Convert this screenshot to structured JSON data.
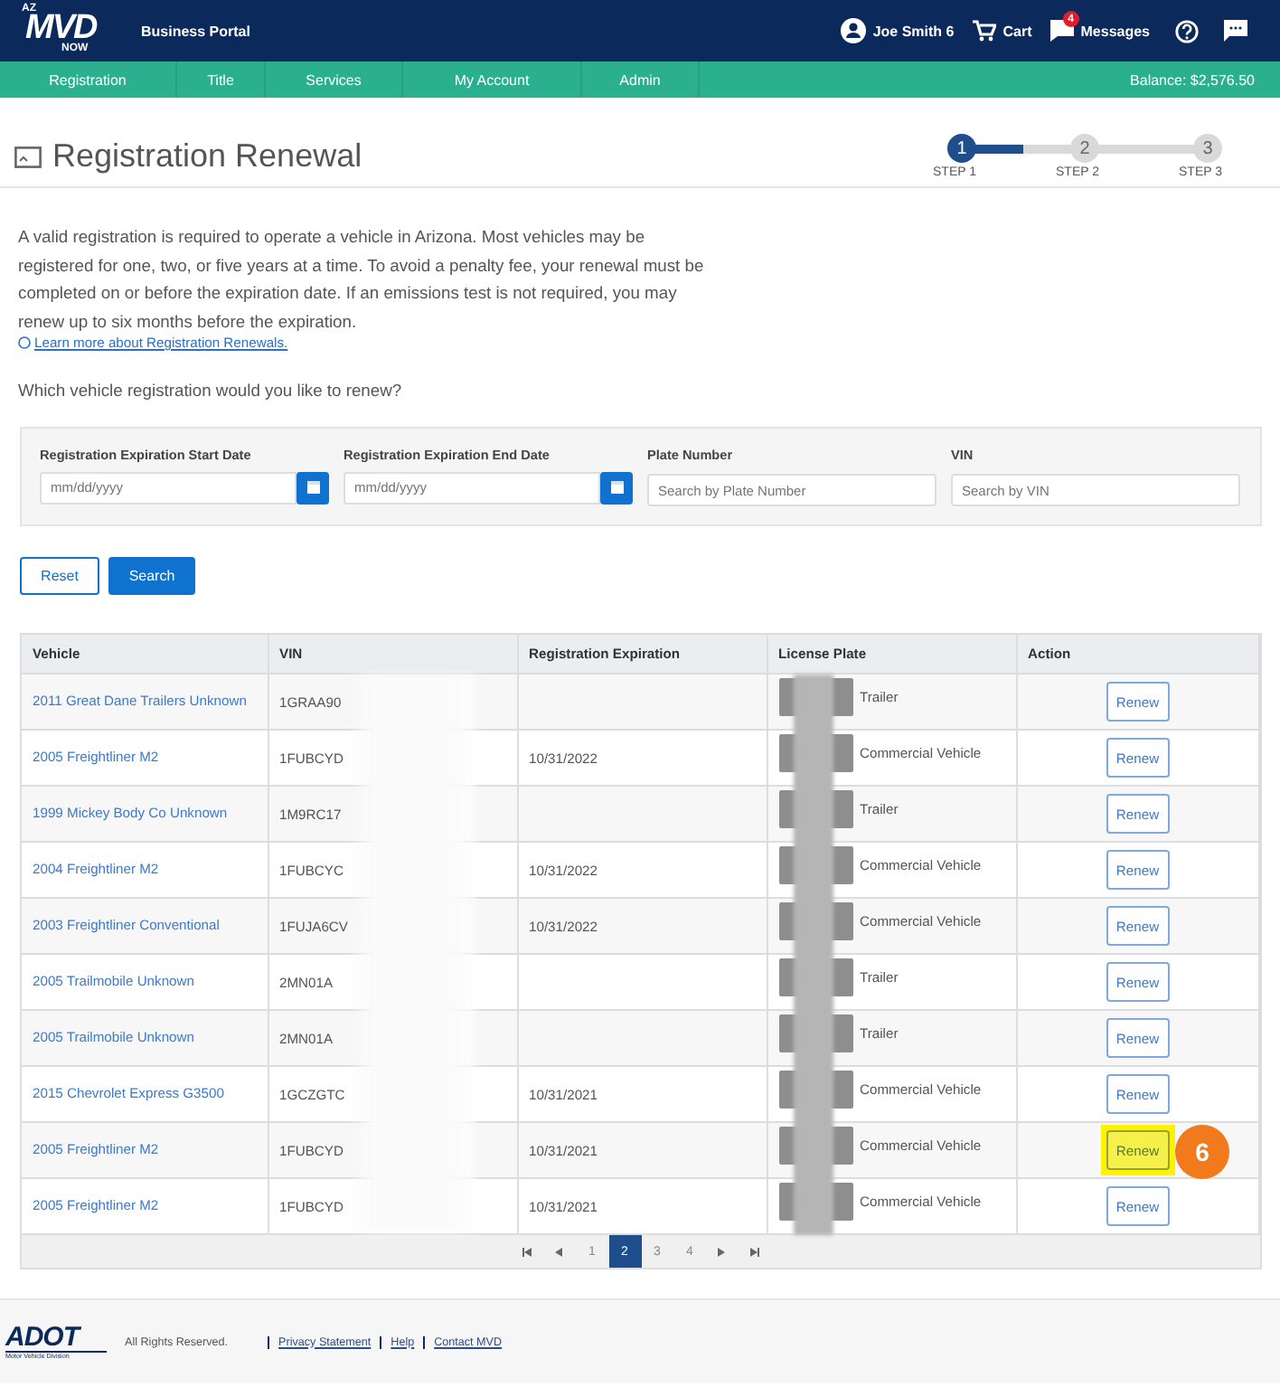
{
  "header": {
    "logo": {
      "state": "AZ",
      "name": "MVD",
      "sub": "NOW"
    },
    "portal": "Business Portal",
    "user": "Joe Smith 6",
    "cart": "Cart",
    "messages": {
      "label": "Messages",
      "badge": "4"
    }
  },
  "nav": {
    "items": [
      {
        "label": "Registration"
      },
      {
        "label": "Title"
      },
      {
        "label": "Services"
      },
      {
        "label": "My Account"
      },
      {
        "label": "Admin"
      }
    ],
    "balance": "Balance: $2,576.50"
  },
  "page": {
    "title": "Registration Renewal",
    "steps": [
      {
        "number": "1",
        "label": "STEP 1",
        "selected": true
      },
      {
        "number": "2",
        "label": "STEP 2",
        "selected": false
      },
      {
        "number": "3",
        "label": "STEP 3",
        "selected": false
      }
    ]
  },
  "intro": {
    "text": "A valid registration is required to operate a vehicle in Arizona. Most vehicles may be registered for one, two, or five years at a time. To avoid a penalty fee, your renewal must be completed on or before the expiration date. If an emissions test is not required, you may renew up to six months before the expiration.",
    "link": "Learn more about Registration Renewals.",
    "question": "Which vehicle registration would you like to renew?"
  },
  "filters": [
    {
      "kind": "date",
      "label": "Registration Expiration Start Date",
      "placeholder": "mm/dd/yyyy"
    },
    {
      "kind": "date",
      "label": "Registration Expiration End Date",
      "placeholder": "mm/dd/yyyy"
    },
    {
      "kind": "text",
      "label": "Plate Number",
      "placeholder": "Search by Plate Number"
    },
    {
      "kind": "text",
      "label": "VIN",
      "placeholder": "Search by VIN"
    }
  ],
  "buttons": {
    "reset": "Reset",
    "search": "Search"
  },
  "table": {
    "columns": [
      "Vehicle",
      "VIN",
      "Registration Expiration",
      "License Plate",
      "Action"
    ],
    "rows": [
      {
        "vehicle": "2011 Great Dane Trailers Unknown",
        "vin": "1GRAA90",
        "expiration": "",
        "plate_type": "Trailer",
        "action": "Renew",
        "highlighted": false
      },
      {
        "vehicle": "2005 Freightliner M2",
        "vin": "1FUBCYD",
        "expiration": "10/31/2022",
        "plate_type": "Commercial Vehicle",
        "action": "Renew",
        "highlighted": false
      },
      {
        "vehicle": "1999 Mickey Body Co Unknown",
        "vin": "1M9RC17",
        "expiration": "",
        "plate_type": "Trailer",
        "action": "Renew",
        "highlighted": false
      },
      {
        "vehicle": "2004 Freightliner M2",
        "vin": "1FUBCYC",
        "expiration": "10/31/2022",
        "plate_type": "Commercial Vehicle",
        "action": "Renew",
        "highlighted": false
      },
      {
        "vehicle": "2003 Freightliner Conventional",
        "vin": "1FUJA6CV",
        "expiration": "10/31/2022",
        "plate_type": "Commercial Vehicle",
        "action": "Renew",
        "highlighted": false
      },
      {
        "vehicle": "2005 Trailmobile Unknown",
        "vin": "2MN01A",
        "expiration": "",
        "plate_type": "Trailer",
        "action": "Renew",
        "highlighted": false
      },
      {
        "vehicle": "2005 Trailmobile Unknown",
        "vin": "2MN01A",
        "expiration": "",
        "plate_type": "Trailer",
        "action": "Renew",
        "highlighted": false
      },
      {
        "vehicle": "2015 Chevrolet Express G3500",
        "vin": "1GCZGTC",
        "expiration": "10/31/2021",
        "plate_type": "Commercial Vehicle",
        "action": "Renew",
        "highlighted": false
      },
      {
        "vehicle": "2005 Freightliner M2",
        "vin": "1FUBCYD",
        "expiration": "10/31/2021",
        "plate_type": "Commercial Vehicle",
        "action": "Renew",
        "highlighted": true
      },
      {
        "vehicle": "2005 Freightliner M2",
        "vin": "1FUBCYD",
        "expiration": "10/31/2021",
        "plate_type": "Commercial Vehicle",
        "action": "Renew",
        "highlighted": false
      }
    ],
    "pages": [
      {
        "label": "1",
        "selected": false
      },
      {
        "label": "2",
        "selected": true
      },
      {
        "label": "3",
        "selected": false
      },
      {
        "label": "4",
        "selected": false
      }
    ]
  },
  "callout": "6",
  "footer": {
    "logo": "ADOT",
    "logo_sub": "Motor Vehicle Division",
    "rights": "All Rights Reserved.",
    "links": [
      "Privacy Statement",
      "Help",
      "Contact MVD"
    ]
  }
}
